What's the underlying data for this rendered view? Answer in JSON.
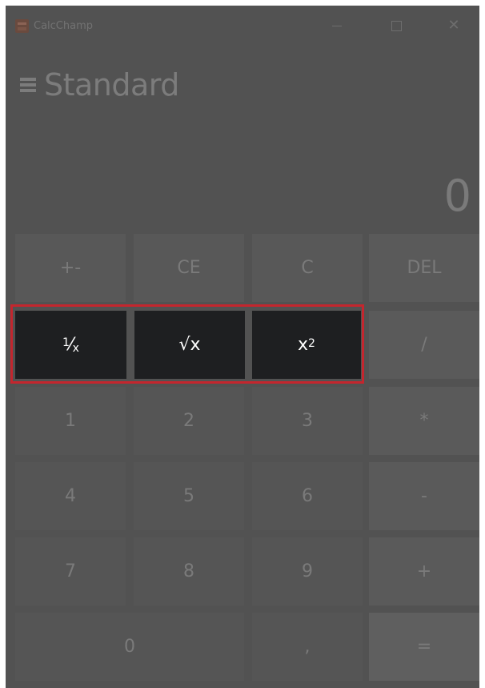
{
  "window": {
    "title": "CalcChamp",
    "controls": {
      "minimize_icon": "minimize-icon",
      "maximize_icon": "maximize-icon",
      "close_icon": "close-icon",
      "close_glyph": "✕"
    }
  },
  "header": {
    "menu_icon": "hamburger-menu-icon",
    "mode": "Standard"
  },
  "display": {
    "value": "0"
  },
  "keys": {
    "row1": [
      "+-",
      "CE",
      "C",
      "DEL"
    ],
    "row2": {
      "reciprocal": {
        "num": "1",
        "slash": "⁄",
        "x": "x"
      },
      "sqrt": "√x",
      "square_base": "x",
      "square_exp": "2",
      "divide": "/"
    },
    "row3": [
      "1",
      "2",
      "3",
      "*"
    ],
    "row4": [
      "4",
      "5",
      "6",
      "-"
    ],
    "row5": [
      "7",
      "8",
      "9",
      "+"
    ],
    "row6": {
      "zero": "0",
      "decimal": ",",
      "equals": "="
    }
  },
  "colors": {
    "background": "#525252",
    "highlight_border": "#c4262e",
    "active_key": "#1e1f21"
  }
}
